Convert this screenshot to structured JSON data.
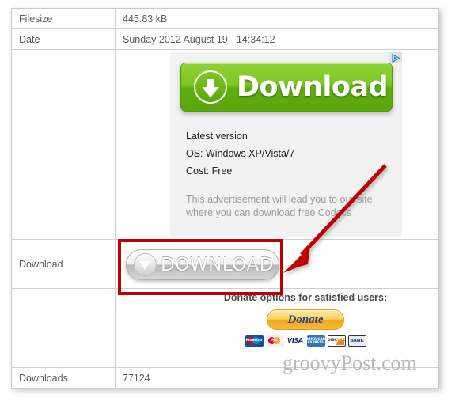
{
  "table": {
    "rows": [
      {
        "label": "Filesize",
        "value": "445.83 kB"
      },
      {
        "label": "Date",
        "value": "Sunday 2012 August 19 - 14:34:12"
      },
      {
        "label": "Download",
        "value": ""
      },
      {
        "label": "Downloads",
        "value": "77124"
      }
    ]
  },
  "ad": {
    "adchoices_icon": "adchoices-triangle-icon",
    "button_label": "Download",
    "button_icon": "download-arrow-icon",
    "line1": "Latest version",
    "line2": "OS: Windows XP/Vista/7",
    "line3": "Cost: Free",
    "disclaimer": "This advertisement will lead you to our site where you can download free Codecs",
    "colors": {
      "green_top": "#8fd235",
      "green_bottom": "#5aa70d",
      "panel_bg": "#f2f2f2"
    }
  },
  "download": {
    "row_label": "Download",
    "button_label": "DOWNLOAD",
    "button_icon": "download-triangle-icon"
  },
  "donate": {
    "title": "Donate options for satisfied users:",
    "button_label": "Donate",
    "cards": [
      {
        "name": "maestro-card-icon",
        "label": "Maestro"
      },
      {
        "name": "mastercard-card-icon",
        "label": "MasterCard"
      },
      {
        "name": "visa-card-icon",
        "label": "VISA"
      },
      {
        "name": "amex-card-icon",
        "label": "AMERICAN EXPRESS"
      },
      {
        "name": "discover-card-icon",
        "label": "DISCOVER"
      },
      {
        "name": "bank-card-icon",
        "label": "BANK"
      }
    ],
    "button_color": "#f5a623"
  },
  "downloads": {
    "label": "Downloads",
    "value": "77124"
  },
  "annotations": {
    "highlight_color": "#c00000",
    "arrow_name": "red-callout-arrow",
    "box_name": "red-highlight-box"
  },
  "watermark": {
    "text": "groovyPost.com"
  }
}
